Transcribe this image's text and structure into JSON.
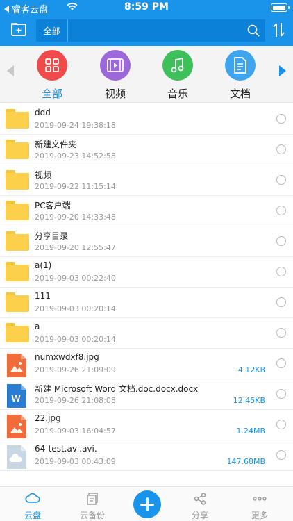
{
  "status_bar": {
    "back_app": "睿客云盘",
    "time": "8:59 PM"
  },
  "toolbar": {
    "search_scope": "全部"
  },
  "categories": [
    {
      "label": "全部",
      "color": "#f04a4a",
      "icon": "grid-icon",
      "active": true
    },
    {
      "label": "视频",
      "color": "#9b67d9",
      "icon": "video-icon",
      "active": false
    },
    {
      "label": "音乐",
      "color": "#3dbf5a",
      "icon": "music-icon",
      "active": false
    },
    {
      "label": "文档",
      "color": "#3fa4ee",
      "icon": "document-icon",
      "active": false
    }
  ],
  "files": [
    {
      "name": "ddd",
      "date": "2019-09-24 19:38:18",
      "size": "",
      "type": "folder"
    },
    {
      "name": "新建文件夹",
      "date": "2019-09-23 14:52:58",
      "size": "",
      "type": "folder"
    },
    {
      "name": "视频",
      "date": "2019-09-22 11:15:14",
      "size": "",
      "type": "folder"
    },
    {
      "name": "PC客户端",
      "date": "2019-09-20 14:33:48",
      "size": "",
      "type": "folder"
    },
    {
      "name": "分享目录",
      "date": "2019-09-20 12:55:47",
      "size": "",
      "type": "folder"
    },
    {
      "name": "a(1)",
      "date": "2019-09-03 00:22:40",
      "size": "",
      "type": "folder"
    },
    {
      "name": "111",
      "date": "2019-09-03 00:20:14",
      "size": "",
      "type": "folder"
    },
    {
      "name": "a",
      "date": "2019-09-03 00:20:14",
      "size": "",
      "type": "folder"
    },
    {
      "name": "numxwdxf8.jpg",
      "date": "2019-09-26 21:09:09",
      "size": "4.12KB",
      "type": "image"
    },
    {
      "name": "新建 Microsoft Word 文档.doc.docx.docx",
      "date": "2019-09-26 21:08:08",
      "size": "12.45KB",
      "type": "word"
    },
    {
      "name": "22.jpg",
      "date": "2019-09-03 16:04:57",
      "size": "1.24MB",
      "type": "image"
    },
    {
      "name": "64-test.avi.avi.",
      "date": "2019-09-03 00:43:09",
      "size": "147.68MB",
      "type": "cloud"
    }
  ],
  "tabbar": {
    "cloud": "云盘",
    "backup": "云备份",
    "share": "分享",
    "more": "更多"
  },
  "colors": {
    "accent": "#1a93eb",
    "folder": "#fcd04b",
    "image_file": "#f26b3a",
    "word_file": "#2b7cd3"
  }
}
